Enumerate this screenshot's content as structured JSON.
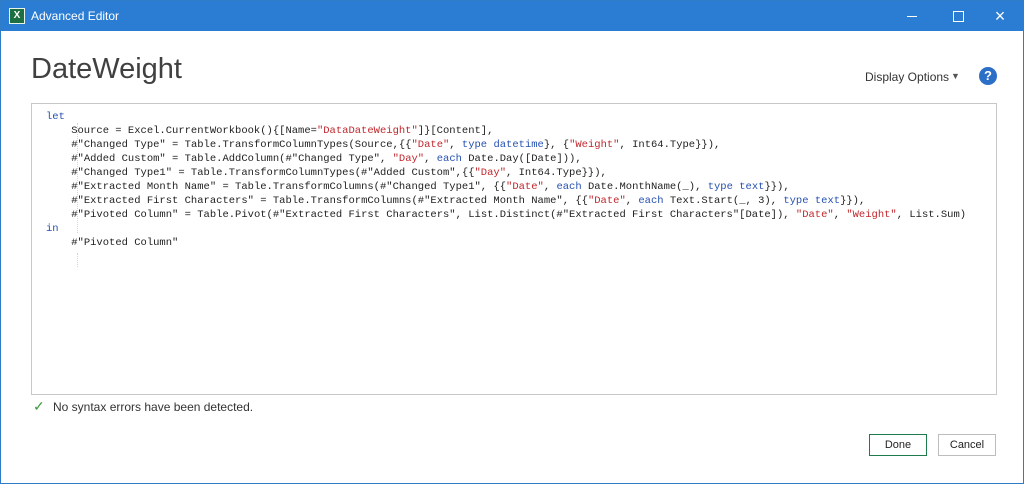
{
  "window": {
    "app_icon": "excel-icon",
    "title": "Advanced Editor",
    "icon_text": "X",
    "controls": [
      "minimize-icon",
      "maximize-icon",
      "close-icon"
    ]
  },
  "header": {
    "query_name": "DateWeight",
    "display_options_label": "Display Options",
    "help_icon": "question-mark-icon"
  },
  "editor": {
    "lines": [
      {
        "text": "let",
        "kind": "keyword"
      },
      {
        "text": "    Source = Excel.CurrentWorkbook(){[Name=\"DataDateWeight\"]}[Content],"
      },
      {
        "text": "    #\"Changed Type\" = Table.TransformColumnTypes(Source,{{\"Date\", type datetime}, {\"Weight\", Int64.Type}}),"
      },
      {
        "text": "    #\"Added Custom\" = Table.AddColumn(#\"Changed Type\", \"Day\", each Date.Day([Date])),"
      },
      {
        "text": "    #\"Changed Type1\" = Table.TransformColumnTypes(#\"Added Custom\",{{\"Day\", Int64.Type}}),"
      },
      {
        "text": "    #\"Extracted Month Name\" = Table.TransformColumns(#\"Changed Type1\", {{\"Date\", each Date.MonthName(_), type text}}),"
      },
      {
        "text": "    #\"Extracted First Characters\" = Table.TransformColumns(#\"Extracted Month Name\", {{\"Date\", each Text.Start(_, 3), type text}}),"
      },
      {
        "text": "    #\"Pivoted Column\" = Table.Pivot(#\"Extracted First Characters\", List.Distinct(#\"Extracted First Characters\"[Date]), \"Date\", \"Weight\", List.Sum)"
      },
      {
        "text": "in",
        "kind": "keyword"
      },
      {
        "text": "    #\"Pivoted Column\""
      }
    ]
  },
  "status": {
    "icon": "checkmark-icon",
    "text": "No syntax errors have been detected."
  },
  "buttons": {
    "done_label": "Done",
    "cancel_label": "Cancel"
  },
  "colors": {
    "titlebar": "#2b7cd3",
    "keyword": "#2550b0",
    "string": "#c1272d",
    "success": "#3c9a3c"
  }
}
